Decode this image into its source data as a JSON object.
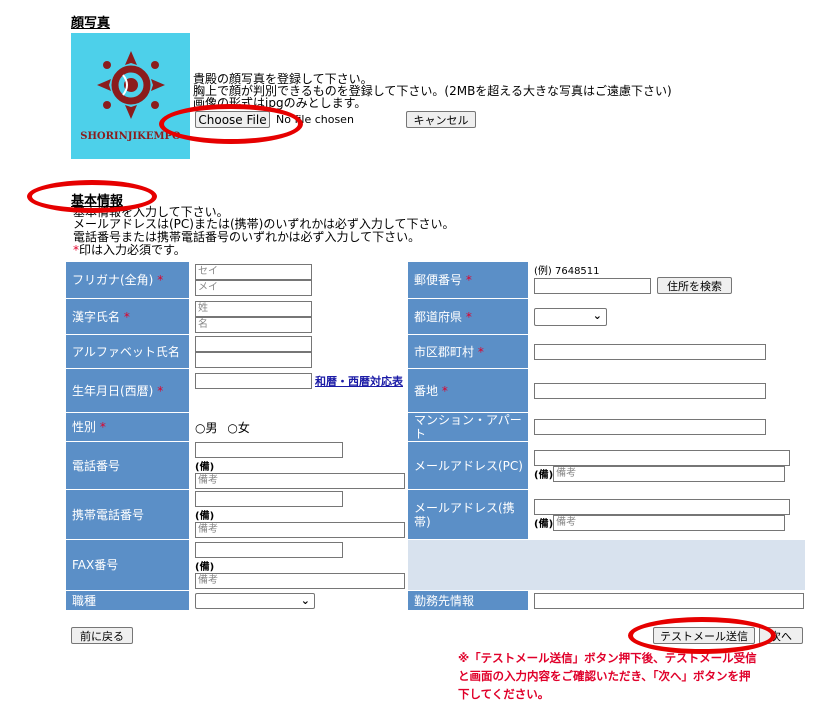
{
  "photo": {
    "title": "顔写真",
    "logo_text": "SHORINJIKEMPO",
    "lines": [
      "貴殿の顔写真を登録して下さい。",
      "胸上で顔が判別できるものを登録して下さい。(2MBを超える大きな写真はご遠慮下さい)",
      "画像の形式はjpgのみとします。"
    ],
    "choose_file": "Choose File",
    "no_file": "No file chosen",
    "cancel": "キャンセル"
  },
  "basic": {
    "title": "基本情報",
    "lines": [
      "基本情報を入力して下さい。",
      "メールアドレスは(PC)または(携帯)のいずれかは必ず入力して下さい。",
      "電話番号または携帯電話番号のいずれかは必ず入力して下さい。"
    ],
    "required_mark": "*",
    "required_note": "印は入力必須です。"
  },
  "form": {
    "req": "*",
    "furigana": {
      "label": "フリガナ(全角)",
      "ph_sei": "セイ",
      "ph_mei": "メイ"
    },
    "kanji": {
      "label": "漢字氏名",
      "ph_sei": "姓",
      "ph_mei": "名"
    },
    "alpha": {
      "label": "アルファベット氏名"
    },
    "birth": {
      "label": "生年月日(西暦)",
      "link": "和暦・西暦対応表"
    },
    "gender": {
      "label": "性別",
      "male": "男",
      "female": "女"
    },
    "phone": {
      "label": "電話番号",
      "note_label": "(備)",
      "note_ph": "備考"
    },
    "mobile": {
      "label": "携帯電話番号",
      "note_label": "(備)",
      "note_ph": "備考"
    },
    "fax": {
      "label": "FAX番号",
      "note_label": "(備)",
      "note_ph": "備考"
    },
    "job": {
      "label": "職種"
    },
    "postal": {
      "label": "郵便番号",
      "example": "(例) 7648511",
      "search": "住所を検索"
    },
    "pref": {
      "label": "都道府県"
    },
    "city": {
      "label": "市区郡町村"
    },
    "address": {
      "label": "番地"
    },
    "building": {
      "label": "マンション・アパート"
    },
    "email_pc": {
      "label": "メールアドレス(PC)",
      "note_label": "(備)",
      "note_ph": "備考"
    },
    "email_mobile": {
      "label": "メールアドレス(携帯)",
      "note_label": "(備)",
      "note_ph": "備考"
    },
    "work": {
      "label": "勤務先情報"
    }
  },
  "actions": {
    "back": "前に戻る",
    "test_mail": "テストメール送信",
    "next": "次へ"
  },
  "notice": [
    "※「テストメール送信」ボタン押下後、テストメール受信",
    "と画面の入力内容をご確認いただき、「次へ」ボタンを押",
    "下してください。"
  ],
  "colors": {
    "label_bg": "#5b8fc7",
    "required": "#e0002a",
    "highlight": "#e60000",
    "logo_bg": "#4dd0ea"
  }
}
